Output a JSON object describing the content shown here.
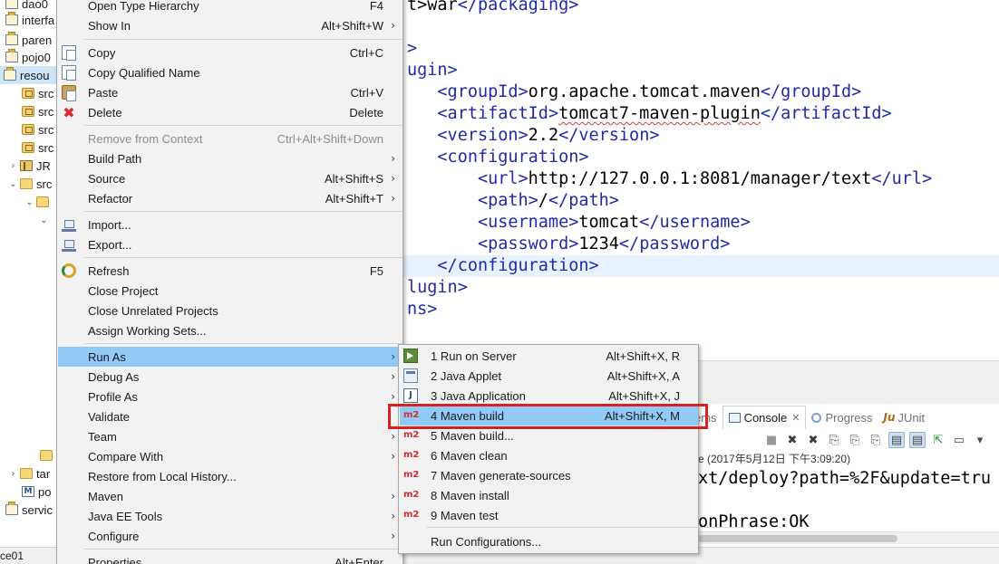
{
  "explorer": {
    "items": [
      {
        "twisty": "",
        "icon": "proj",
        "label": "dao0"
      },
      {
        "twisty": "",
        "icon": "proj",
        "label": "interfa"
      },
      {
        "twisty": "",
        "icon": "proj",
        "label": "paren"
      },
      {
        "twisty": "",
        "icon": "proj",
        "label": "pojo0"
      },
      {
        "twisty": "",
        "icon": "proj",
        "label": "resou",
        "selected": true
      },
      {
        "twisty": "",
        "icon": "pkg",
        "label": "src"
      },
      {
        "twisty": "",
        "icon": "pkg",
        "label": "src"
      },
      {
        "twisty": "",
        "icon": "pkg",
        "label": "src"
      },
      {
        "twisty": "",
        "icon": "pkg",
        "label": "src"
      },
      {
        "twisty": "›",
        "icon": "lib",
        "label": "JR"
      },
      {
        "twisty": "⌄",
        "icon": "fold",
        "label": "src"
      },
      {
        "twisty": "⌄",
        "icon": "fold",
        "label": ""
      },
      {
        "twisty": "⌄",
        "icon": "",
        "label": ""
      },
      {
        "twisty": "",
        "icon": "fold",
        "label": ""
      },
      {
        "twisty": "›",
        "icon": "fold",
        "label": "tar"
      },
      {
        "twisty": "",
        "icon": "m",
        "label": "po"
      },
      {
        "twisty": "",
        "icon": "proj",
        "label": "servic"
      }
    ]
  },
  "editor": {
    "lines": [
      {
        "indent": "",
        "parts": [
          {
            "k": "txt",
            "t": "t>"
          },
          {
            "k": "txt",
            "t": "war"
          },
          {
            "k": "tag",
            "t": "</packaging>"
          }
        ]
      },
      {
        "indent": "",
        "parts": []
      },
      {
        "indent": "",
        "parts": [
          {
            "k": "tag",
            "t": ">"
          }
        ]
      },
      {
        "indent": "",
        "parts": [
          {
            "k": "tag",
            "t": "ugin>"
          }
        ]
      },
      {
        "indent": "   ",
        "parts": [
          {
            "k": "tag",
            "t": "<groupId>"
          },
          {
            "k": "txt",
            "t": "org.apache.tomcat.maven"
          },
          {
            "k": "tag",
            "t": "</groupId>"
          }
        ]
      },
      {
        "indent": "   ",
        "parts": [
          {
            "k": "tag",
            "t": "<artifactId>"
          },
          {
            "k": "sq",
            "t": "tomcat7-maven-plugin"
          },
          {
            "k": "tag",
            "t": "</artifactId>"
          }
        ]
      },
      {
        "indent": "   ",
        "parts": [
          {
            "k": "tag",
            "t": "<version>"
          },
          {
            "k": "txt",
            "t": "2.2"
          },
          {
            "k": "tag",
            "t": "</version>"
          }
        ]
      },
      {
        "indent": "   ",
        "parts": [
          {
            "k": "tag",
            "t": "<configuration>"
          }
        ]
      },
      {
        "indent": "       ",
        "parts": [
          {
            "k": "tag",
            "t": "<url>"
          },
          {
            "k": "txt",
            "t": "http://127.0.0.1:8081/manager/text"
          },
          {
            "k": "tag",
            "t": "</url>"
          }
        ]
      },
      {
        "indent": "       ",
        "parts": [
          {
            "k": "tag",
            "t": "<path>"
          },
          {
            "k": "txt",
            "t": "/"
          },
          {
            "k": "tag",
            "t": "</path>"
          }
        ]
      },
      {
        "indent": "       ",
        "parts": [
          {
            "k": "tag",
            "t": "<username>"
          },
          {
            "k": "txt",
            "t": "tomcat"
          },
          {
            "k": "tag",
            "t": "</username>"
          }
        ]
      },
      {
        "indent": "       ",
        "parts": [
          {
            "k": "tag",
            "t": "<password>"
          },
          {
            "k": "txt",
            "t": "1234"
          },
          {
            "k": "tag",
            "t": "</password>"
          }
        ]
      },
      {
        "indent": "   ",
        "parts": [
          {
            "k": "tag",
            "t": "</configuration>"
          }
        ],
        "highlight": true
      },
      {
        "indent": "",
        "parts": [
          {
            "k": "tag",
            "t": "lugin>"
          }
        ]
      },
      {
        "indent": "",
        "parts": [
          {
            "k": "tag",
            "t": "ns>"
          }
        ]
      }
    ]
  },
  "context_menu": {
    "items": [
      {
        "label": "Open Type Hierarchy",
        "accel": "F4",
        "icon": ""
      },
      {
        "label": "Show In",
        "accel": "Alt+Shift+W",
        "submenu": true,
        "icon": ""
      },
      {
        "sep": true
      },
      {
        "label": "Copy",
        "accel": "Ctrl+C",
        "icon": "copy"
      },
      {
        "label": "Copy Qualified Name",
        "accel": "",
        "icon": "copy"
      },
      {
        "label": "Paste",
        "accel": "Ctrl+V",
        "icon": "paste"
      },
      {
        "label": "Delete",
        "accel": "Delete",
        "icon": "delete"
      },
      {
        "sep": true
      },
      {
        "label": "Remove from Context",
        "accel": "Ctrl+Alt+Shift+Down",
        "disabled": true,
        "icon": ""
      },
      {
        "label": "Build Path",
        "accel": "",
        "submenu": true,
        "icon": ""
      },
      {
        "label": "Source",
        "accel": "Alt+Shift+S",
        "submenu": true,
        "icon": ""
      },
      {
        "label": "Refactor",
        "accel": "Alt+Shift+T",
        "submenu": true,
        "icon": ""
      },
      {
        "sep": true
      },
      {
        "label": "Import...",
        "accel": "",
        "icon": "import"
      },
      {
        "label": "Export...",
        "accel": "",
        "icon": "export"
      },
      {
        "sep": true
      },
      {
        "label": "Refresh",
        "accel": "F5",
        "icon": "refresh"
      },
      {
        "label": "Close Project",
        "accel": "",
        "icon": ""
      },
      {
        "label": "Close Unrelated Projects",
        "accel": "",
        "icon": ""
      },
      {
        "label": "Assign Working Sets...",
        "accel": "",
        "icon": ""
      },
      {
        "sep": true
      },
      {
        "label": "Run As",
        "accel": "",
        "submenu": true,
        "hover": true,
        "icon": ""
      },
      {
        "label": "Debug As",
        "accel": "",
        "submenu": true,
        "icon": ""
      },
      {
        "label": "Profile As",
        "accel": "",
        "submenu": true,
        "icon": ""
      },
      {
        "label": "Validate",
        "accel": "",
        "icon": ""
      },
      {
        "label": "Team",
        "accel": "",
        "submenu": true,
        "icon": ""
      },
      {
        "label": "Compare With",
        "accel": "",
        "submenu": true,
        "icon": ""
      },
      {
        "label": "Restore from Local History...",
        "accel": "",
        "icon": ""
      },
      {
        "label": "Maven",
        "accel": "",
        "submenu": true,
        "icon": ""
      },
      {
        "label": "Java EE Tools",
        "accel": "",
        "submenu": true,
        "icon": ""
      },
      {
        "label": "Configure",
        "accel": "",
        "submenu": true,
        "icon": ""
      },
      {
        "sep": true
      },
      {
        "label": "Properties",
        "accel": "Alt+Enter",
        "icon": ""
      }
    ]
  },
  "run_as_menu": {
    "items": [
      {
        "label": "1 Run on Server",
        "accel": "Alt+Shift+X, R",
        "icon": "server"
      },
      {
        "label": "2 Java Applet",
        "accel": "Alt+Shift+X, A",
        "icon": "applet"
      },
      {
        "label": "3 Java Application",
        "accel": "Alt+Shift+X, J",
        "icon": "java"
      },
      {
        "label": "4 Maven build",
        "accel": "Alt+Shift+X, M",
        "icon": "m2",
        "hover": true
      },
      {
        "label": "5 Maven build...",
        "accel": "",
        "icon": "m2"
      },
      {
        "label": "6 Maven clean",
        "accel": "",
        "icon": "m2"
      },
      {
        "label": "7 Maven generate-sources",
        "accel": "",
        "icon": "m2"
      },
      {
        "label": "8 Maven install",
        "accel": "",
        "icon": "m2"
      },
      {
        "label": "9 Maven test",
        "accel": "",
        "icon": "m2"
      },
      {
        "sep": true
      },
      {
        "label": "Run Configurations...",
        "accel": "",
        "icon": ""
      }
    ],
    "icon_text": {
      "m2": "m2",
      "java": "J"
    }
  },
  "views": {
    "tabs": [
      {
        "label": "ems",
        "active": false,
        "kind": "problems"
      },
      {
        "label": "Console",
        "active": true,
        "kind": "console",
        "close": "✕"
      },
      {
        "label": "Progress",
        "active": false,
        "kind": "progress"
      },
      {
        "label": "JUnit",
        "active": false,
        "kind": "junit",
        "prefix": "Ju"
      }
    ],
    "toolbar": [
      "■",
      "✖",
      "✖",
      "⎘",
      "⎘",
      "⎘",
      "▤",
      "▤",
      "⇱",
      "▭",
      "▾"
    ]
  },
  "console": {
    "header": "e (2017年5月12日 下午3:09:20)",
    "lines": [
      "xt/deploy?path=%2F&update=tru",
      "",
      "onPhrase:OK"
    ]
  },
  "status_bar": {
    "text": "ce01"
  },
  "colors": {
    "menu_hover": "#91c9f7",
    "highlight_box": "#d9221f",
    "xml_tag": "#1f2ba8"
  }
}
